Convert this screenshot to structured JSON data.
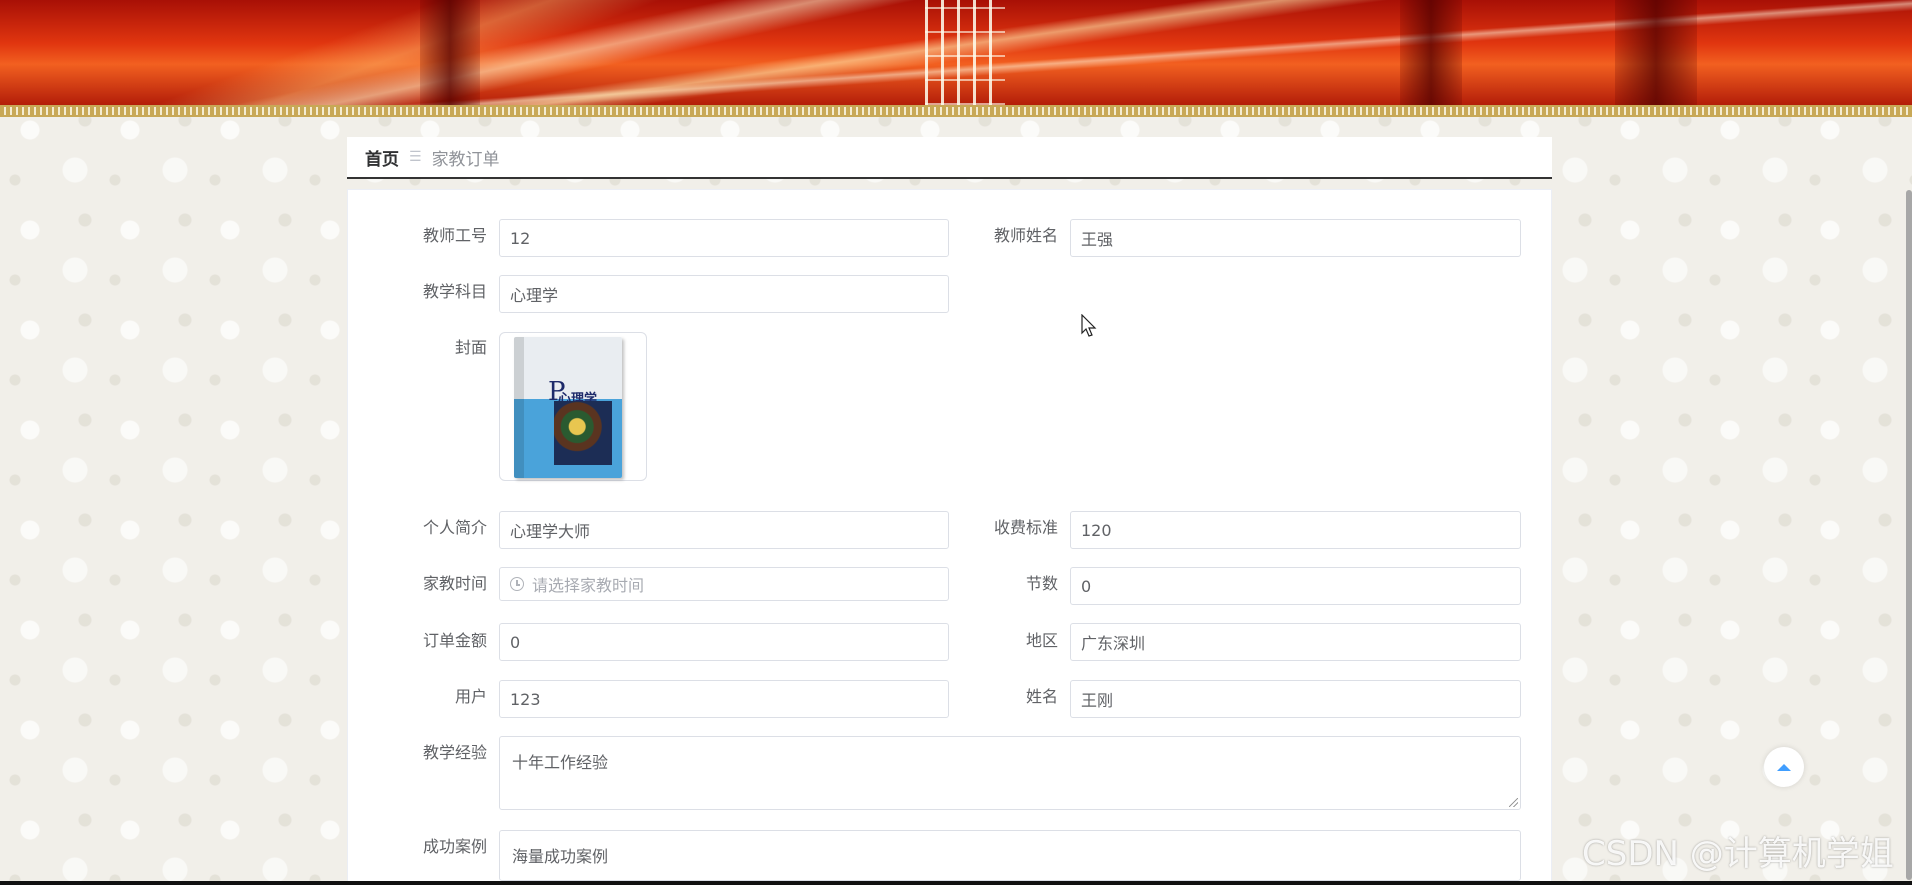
{
  "breadcrumb": {
    "home": "首页",
    "separator": "☰",
    "current": "家教订单"
  },
  "form": {
    "teacher_id": {
      "label": "教师工号",
      "value": "12"
    },
    "teacher_name": {
      "label": "教师姓名",
      "value": "王强"
    },
    "subject": {
      "label": "教学科目",
      "value": "心理学"
    },
    "cover": {
      "label": "封面",
      "book_title": "心理学",
      "book_letter": "P"
    },
    "intro": {
      "label": "个人简介",
      "value": "心理学大师"
    },
    "fee": {
      "label": "收费标准",
      "value": "120"
    },
    "tutor_time": {
      "label": "家教时间",
      "placeholder": "请选择家教时间"
    },
    "sessions": {
      "label": "节数",
      "value": "0"
    },
    "order_amount": {
      "label": "订单金额",
      "value": "0"
    },
    "region": {
      "label": "地区",
      "value": "广东深圳"
    },
    "user": {
      "label": "用户",
      "value": "123"
    },
    "name": {
      "label": "姓名",
      "value": "王刚"
    },
    "experience": {
      "label": "教学经验",
      "value": "十年工作经验"
    },
    "cases": {
      "label": "成功案例",
      "value": "海量成功案例"
    }
  },
  "watermark": "CSDN @计算机学姐",
  "colors": {
    "accent": "#409eff",
    "banner": "#e0350f"
  }
}
